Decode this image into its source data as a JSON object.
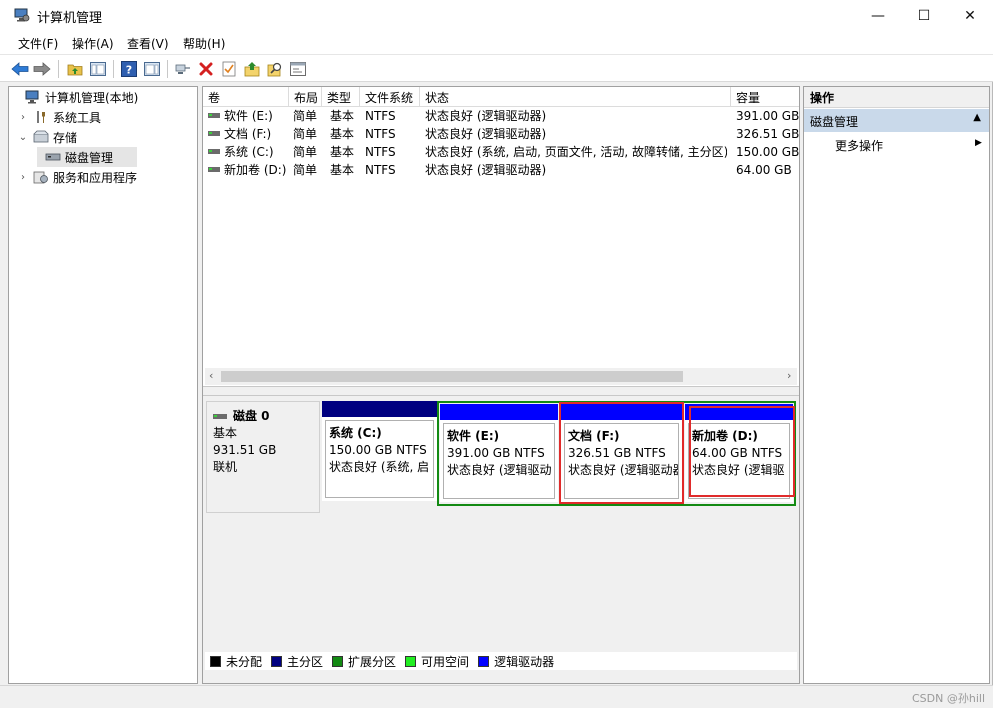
{
  "window": {
    "title": "计算机管理",
    "controls": [
      "—",
      "☐",
      "✕"
    ]
  },
  "menu": [
    "文件(F)",
    "操作(A)",
    "查看(V)",
    "帮助(H)"
  ],
  "toolbar": {
    "icons": [
      "back-icon",
      "forward-icon",
      "folder-up-icon",
      "show-tree-icon",
      "help-icon",
      "properties-pane-icon",
      "connect-icon",
      "delete-icon",
      "checklist-icon",
      "export-up-icon",
      "search-icon",
      "console-icon"
    ]
  },
  "tree": {
    "root": "计算机管理(本地)",
    "system_tools": "系统工具",
    "storage": "存储",
    "disk_management": "磁盘管理",
    "services": "服务和应用程序"
  },
  "volumes": {
    "columns": [
      "卷",
      "布局",
      "类型",
      "文件系统",
      "状态",
      "容量"
    ],
    "rows": [
      {
        "name": "软件 (E:)",
        "layout": "简单",
        "type": "基本",
        "fs": "NTFS",
        "status": "状态良好 (逻辑驱动器)",
        "capacity": "391.00 GB"
      },
      {
        "name": "文档 (F:)",
        "layout": "简单",
        "type": "基本",
        "fs": "NTFS",
        "status": "状态良好 (逻辑驱动器)",
        "capacity": "326.51 GB"
      },
      {
        "name": "系统 (C:)",
        "layout": "简单",
        "type": "基本",
        "fs": "NTFS",
        "status": "状态良好 (系统, 启动, 页面文件, 活动, 故障转储, 主分区)",
        "capacity": "150.00 GB"
      },
      {
        "name": "新加卷 (D:)",
        "layout": "简单",
        "type": "基本",
        "fs": "NTFS",
        "status": "状态良好 (逻辑驱动器)",
        "capacity": "64.00 GB"
      }
    ]
  },
  "disk": {
    "name": "磁盘 0",
    "type": "基本",
    "size": "931.51 GB",
    "state": "联机",
    "partitions": [
      {
        "title": "系统  (C:)",
        "size": "150.00 GB NTFS",
        "status": "状态良好 (系统, 启"
      },
      {
        "title": "软件  (E:)",
        "size": "391.00 GB NTFS",
        "status": "状态良好 (逻辑驱动"
      },
      {
        "title": "文档  (F:)",
        "size": "326.51 GB NTFS",
        "status": "状态良好 (逻辑驱动器"
      },
      {
        "title": "新加卷  (D:)",
        "size": "64.00 GB NTFS",
        "status": "状态良好 (逻辑驱"
      }
    ]
  },
  "legend": [
    {
      "label": "未分配",
      "color": "#000000"
    },
    {
      "label": "主分区",
      "color": "#000080"
    },
    {
      "label": "扩展分区",
      "color": "#138a13"
    },
    {
      "label": "可用空间",
      "color": "#22ee22"
    },
    {
      "label": "逻辑驱动器",
      "color": "#0000ff"
    }
  ],
  "actions": {
    "header": "操作",
    "selected": "磁盘管理",
    "more": "更多操作"
  },
  "watermark": "CSDN @孙hill",
  "colors": {
    "primary_partition": "#000080",
    "logical_drive": "#0000ff",
    "extended_partition": "#138a13",
    "highlight": "#e02b2b",
    "selection": "#c9d9ea"
  }
}
